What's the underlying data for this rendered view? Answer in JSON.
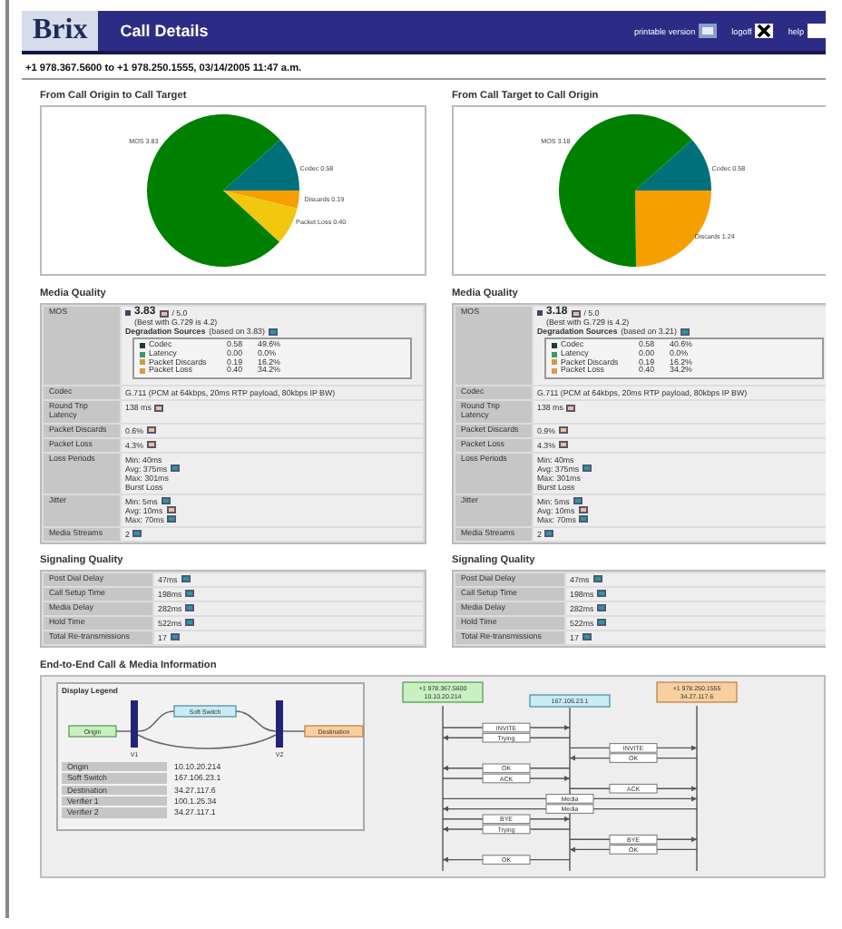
{
  "header": {
    "logo": "Brix",
    "title": "Call Details",
    "links": [
      {
        "label": "printable version",
        "kind": "print"
      },
      {
        "label": "logoff",
        "kind": "close"
      },
      {
        "label": "help",
        "kind": "help"
      }
    ]
  },
  "call_summary": "+1 978.367.5600 to +1 978.250.1555, 03/14/2005 11:47 a.m.",
  "directions": [
    {
      "chart_data": {
        "type": "pie",
        "title": "From Call Origin to Call Target",
        "categories": [
          "MOS",
          "Codec",
          "Discards",
          "Packet Loss"
        ],
        "values": [
          3.83,
          0.58,
          0.19,
          0.4
        ],
        "value_labels": [
          "3.83",
          "0.58",
          "0.19",
          "0.40"
        ]
      },
      "media_quality": {
        "title": "Media Quality",
        "mos": {
          "label": "MOS",
          "score": "3.83",
          "score_badge": {
            "color": "#f2bf90"
          },
          "scale": "/ 5.0",
          "note": "(Best with G.729 is 4.2)",
          "sources_title": "Degradation Sources",
          "sources_basis": "(based on 3.83)",
          "sources_badge": {
            "color": "#1f9ea0"
          },
          "sources": [
            {
              "name": "Codec",
              "value": "0.58",
              "share": "49.6%",
              "color": "#1f3b3b"
            },
            {
              "name": "Latency",
              "value": "0.00",
              "share": "0.0%",
              "color": "#3a9a6a"
            },
            {
              "name": "Packet Discards",
              "value": "0.19",
              "share": "16.2%",
              "color": "#c8a040"
            },
            {
              "name": "Packet Loss",
              "value": "0.40",
              "share": "34.2%",
              "color": "#d99a50"
            }
          ]
        },
        "rows": [
          {
            "label": "Codec",
            "lines": [
              {
                "text": "G.711 (PCM at 64kbps, 20ms RTP payload, 80kbps IP BW)"
              }
            ]
          },
          {
            "label": "Round Trip Latency",
            "lines": [
              {
                "text": "138 ms",
                "badge": {
                  "color": "#f2bf90"
                }
              }
            ]
          },
          {
            "label": "Packet Discards",
            "lines": [
              {
                "text": "0.6%",
                "badge": {
                  "color": "#f2bf90"
                }
              }
            ]
          },
          {
            "label": "Packet Loss",
            "lines": [
              {
                "text": "4.3%",
                "badge": {
                  "color": "#f2bf90"
                }
              }
            ]
          },
          {
            "label": "Loss Periods",
            "lines": [
              {
                "text": "Min: 40ms"
              },
              {
                "text": "Avg: 375ms",
                "badge": {
                  "color": "#1f9ea0"
                }
              },
              {
                "text": "Max: 301ms"
              },
              {
                "text": "Burst Loss"
              }
            ]
          },
          {
            "label": "Jitter",
            "lines": [
              {
                "text": "Min: 5ms",
                "badge": {
                  "color": "#1f9ea0"
                }
              },
              {
                "text": "Avg: 10ms",
                "badge": {
                  "color": "#f2bf90"
                }
              },
              {
                "text": "Max: 70ms",
                "badge": {
                  "color": "#1f9ea0"
                }
              }
            ]
          },
          {
            "label": "Media Streams",
            "lines": [
              {
                "text": "2",
                "badge": {
                  "color": "#1f9ea0"
                }
              }
            ]
          }
        ]
      },
      "signaling_quality": {
        "title": "Signaling Quality",
        "rows": [
          {
            "label": "Post Dial Delay",
            "value": "47ms",
            "badge": {
              "color": "#1f9ea0"
            }
          },
          {
            "label": "Call Setup Time",
            "value": "198ms",
            "badge": {
              "color": "#1f9ea0"
            }
          },
          {
            "label": "Media Delay",
            "value": "282ms",
            "badge": {
              "color": "#1f9ea0"
            }
          },
          {
            "label": "Hold Time",
            "value": "522ms",
            "badge": {
              "color": "#1f9ea0"
            }
          },
          {
            "label": "Total Re-transmissions",
            "value": "17",
            "badge": {
              "color": "#1f9ea0"
            }
          }
        ]
      }
    },
    {
      "chart_data": {
        "type": "pie",
        "title": "From Call Target to Call Origin",
        "categories": [
          "MOS",
          "Codec",
          "Discards"
        ],
        "values": [
          3.18,
          0.58,
          1.24
        ],
        "value_labels": [
          "3.18",
          "0.58",
          "1.24"
        ]
      },
      "media_quality": {
        "title": "Media Quality",
        "mos": {
          "label": "MOS",
          "score": "3.18",
          "score_badge": {
            "color": "#f2bf90"
          },
          "scale": "/ 5.0",
          "note": "(Best with G.729 is 4.2)",
          "sources_title": "Degradation Sources",
          "sources_basis": "(based on 3.21)",
          "sources_badge": {
            "color": "#1f9ea0"
          },
          "sources": [
            {
              "name": "Codec",
              "value": "0.58",
              "share": "40.6%",
              "color": "#1f3b3b"
            },
            {
              "name": "Latency",
              "value": "0.00",
              "share": "0.0%",
              "color": "#3a9a6a"
            },
            {
              "name": "Packet Discards",
              "value": "0.19",
              "share": "16.2%",
              "color": "#c8a040"
            },
            {
              "name": "Packet Loss",
              "value": "0.40",
              "share": "34.2%",
              "color": "#d99a50"
            }
          ]
        },
        "rows": [
          {
            "label": "Codec",
            "lines": [
              {
                "text": "G.711 (PCM at 64kbps, 20ms RTP payload, 80kbps IP BW)"
              }
            ]
          },
          {
            "label": "Round Trip Latency",
            "lines": [
              {
                "text": "138 ms",
                "badge": {
                  "color": "#f2bf90"
                }
              }
            ]
          },
          {
            "label": "Packet Discards",
            "lines": [
              {
                "text": "0.9%",
                "badge": {
                  "color": "#f2bf90"
                }
              }
            ]
          },
          {
            "label": "Packet Loss",
            "lines": [
              {
                "text": "4.3%",
                "badge": {
                  "color": "#f2bf90"
                }
              }
            ]
          },
          {
            "label": "Loss Periods",
            "lines": [
              {
                "text": "Min: 40ms"
              },
              {
                "text": "Avg: 375ms",
                "badge": {
                  "color": "#1f9ea0"
                }
              },
              {
                "text": "Max: 301ms"
              },
              {
                "text": "Burst Loss"
              }
            ]
          },
          {
            "label": "Jitter",
            "lines": [
              {
                "text": "Min: 5ms",
                "badge": {
                  "color": "#1f9ea0"
                }
              },
              {
                "text": "Avg: 10ms",
                "badge": {
                  "color": "#f2bf90"
                }
              },
              {
                "text": "Max: 70ms",
                "badge": {
                  "color": "#1f9ea0"
                }
              }
            ]
          },
          {
            "label": "Media Streams",
            "lines": [
              {
                "text": "2",
                "badge": {
                  "color": "#1f9ea0"
                }
              }
            ]
          }
        ]
      },
      "signaling_quality": {
        "title": "Signaling Quality",
        "rows": [
          {
            "label": "Post Dial Delay",
            "value": "47ms",
            "badge": {
              "color": "#1f9ea0"
            }
          },
          {
            "label": "Call Setup Time",
            "value": "198ms",
            "badge": {
              "color": "#1f9ea0"
            }
          },
          {
            "label": "Media Delay",
            "value": "282ms",
            "badge": {
              "color": "#1f9ea0"
            }
          },
          {
            "label": "Hold Time",
            "value": "522ms",
            "badge": {
              "color": "#1f9ea0"
            }
          },
          {
            "label": "Total Re-transmissions",
            "value": "17",
            "badge": {
              "color": "#1f9ea0"
            }
          }
        ]
      }
    }
  ],
  "end_to_end": {
    "title": "End-to-End Call & Media Information",
    "legend": {
      "title": "Display Legend",
      "nodes": [
        {
          "label": "Origin",
          "kind": "origin"
        },
        {
          "label": "Soft Switch",
          "kind": "switch"
        },
        {
          "label": "Destination",
          "kind": "destination"
        }
      ],
      "verifiers": [
        "V1",
        "V2"
      ],
      "rows": [
        {
          "label": "Origin",
          "value": "10.10.20.214"
        },
        {
          "label": "Soft Switch",
          "value": "167.106.23.1"
        },
        {
          "label": "Destination",
          "value": "34.27.117.6"
        },
        {
          "label": "Verifier 1",
          "value": "100.1.25.34"
        },
        {
          "label": "Verifier 2",
          "value": "34.27.117.1"
        }
      ]
    },
    "sequence": {
      "lanes": [
        {
          "lines": [
            "+1 978.367.5600",
            "10.10.20.214"
          ],
          "kind": "origin"
        },
        {
          "lines": [
            "167.106.23.1"
          ],
          "kind": "switch"
        },
        {
          "lines": [
            "+1 978.250.1555",
            "34.27.117.6"
          ],
          "kind": "destination"
        }
      ],
      "messages": [
        {
          "label": "INVITE",
          "kind": "origin_to_switch"
        },
        {
          "label": "Trying",
          "kind": "switch_to_origin"
        },
        {
          "label": "INVITE",
          "kind": "switch_to_destination"
        },
        {
          "label": "OK",
          "kind": "destination_to_switch"
        },
        {
          "label": "OK",
          "kind": "switch_to_origin"
        },
        {
          "label": "ACK",
          "kind": "origin_to_switch"
        },
        {
          "label": "ACK",
          "kind": "switch_to_destination"
        },
        {
          "label": "Media",
          "kind": "origin_to_destination"
        },
        {
          "label": "Media",
          "kind": "destination_to_origin"
        },
        {
          "label": "BYE",
          "kind": "origin_to_switch"
        },
        {
          "label": "Trying",
          "kind": "switch_to_origin"
        },
        {
          "label": "BYE",
          "kind": "switch_to_destination"
        },
        {
          "label": "OK",
          "kind": "destination_to_switch"
        },
        {
          "label": "OK",
          "kind": "switch_to_origin"
        }
      ]
    }
  }
}
